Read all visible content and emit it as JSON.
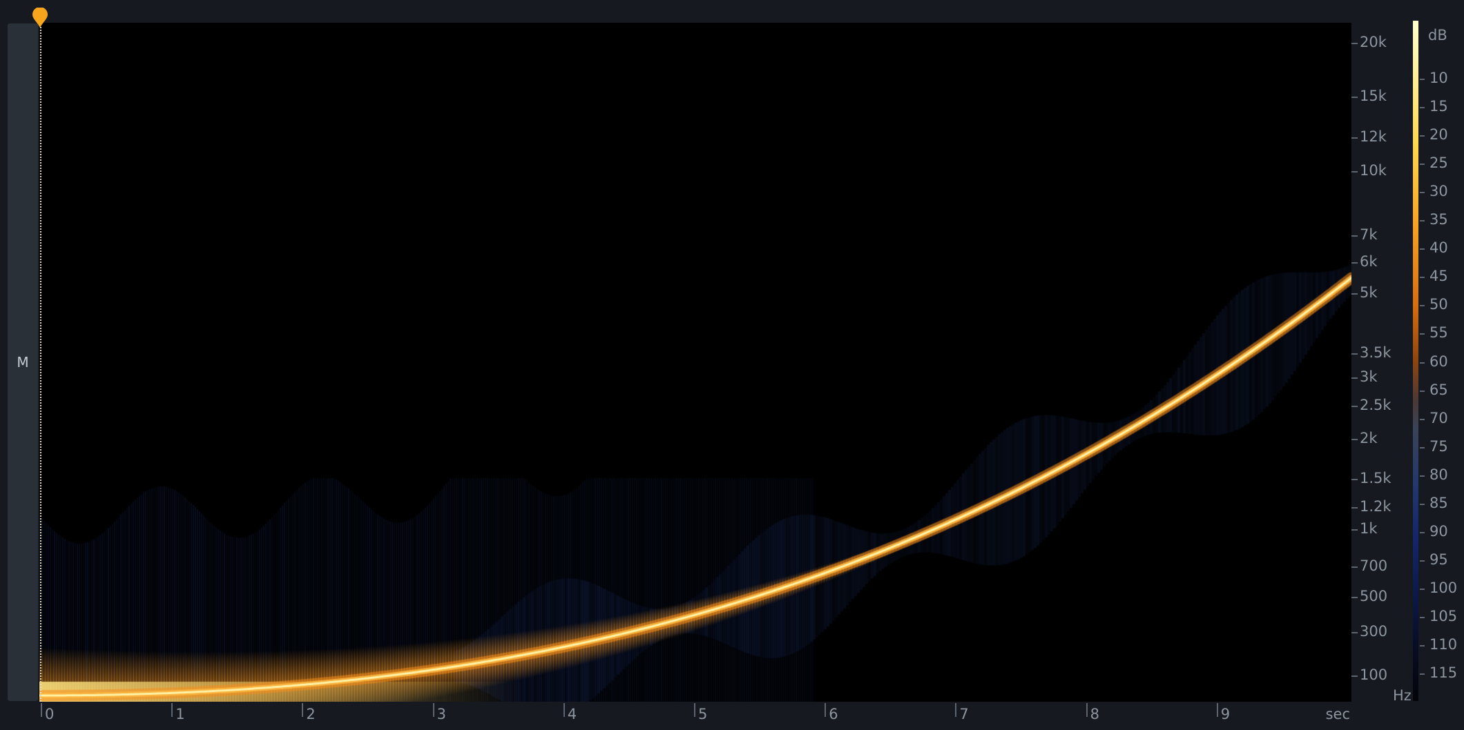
{
  "channel": {
    "label": "M"
  },
  "time_axis": {
    "ticks": [
      "0",
      "1",
      "2",
      "3",
      "4",
      "5",
      "6",
      "7",
      "8",
      "9"
    ],
    "unit": "sec"
  },
  "freq_axis": {
    "ticks": [
      "20k",
      "15k",
      "12k",
      "10k",
      "7k",
      "6k",
      "5k",
      "3.5k",
      "3k",
      "2.5k",
      "2k",
      "1.5k",
      "1.2k",
      "1k",
      "700",
      "500",
      "300",
      "100"
    ],
    "unit": "Hz"
  },
  "db_scale": {
    "unit": "dB",
    "ticks": [
      "10",
      "15",
      "20",
      "25",
      "30",
      "35",
      "40",
      "45",
      "50",
      "55",
      "60",
      "65",
      "70",
      "75",
      "80",
      "85",
      "90",
      "95",
      "100",
      "105",
      "110",
      "115"
    ]
  },
  "colors": {
    "background": "#161a20",
    "channel_bar": "#2a3038",
    "playhead": "#f7a51c",
    "sweep_core": "#fff3a8",
    "sweep_glow": "#f5941e",
    "noise_floor": "#1c3170"
  },
  "icons": {
    "playhead_marker": "playhead-marker-icon"
  }
}
